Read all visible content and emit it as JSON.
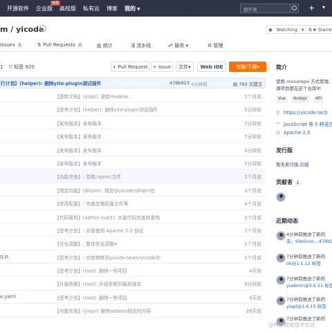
{
  "topnav": {
    "items": [
      "开源软件",
      "企业版",
      "高校版",
      "私有云",
      "博客",
      "我的"
    ],
    "hot_badge": "特惠",
    "search_placeholder": "搜开源"
  },
  "repo": {
    "title": "m / yicode",
    "watch_label": "Watching",
    "watch_count": "5",
    "star_label": "Starred"
  },
  "tabs": [
    {
      "label": "Issues",
      "count": "0"
    },
    {
      "label": "Pull Requests",
      "count": "0"
    },
    {
      "label": "统计"
    },
    {
      "label": "流水线"
    },
    {
      "label": "服务"
    },
    {
      "label": "管理"
    }
  ],
  "toolbar": {
    "stats_prefix": "1",
    "tags_label": "标签 920",
    "pull_request": "+ Pull Request",
    "issue": "+ Issue",
    "file": "文件",
    "web_ide": "Web IDE",
    "clone": "克隆/下载"
  },
  "latest_commit": {
    "message": "行计划】(helper): 删除yite-plugin测试插件",
    "hash": "478b923",
    "time": "4分钟前",
    "total": "793 次提交"
  },
  "files": [
    {
      "name": "",
      "msg": "【更新文档】(yiapi): 更新readme",
      "time": "2个月前"
    },
    {
      "name": "",
      "msg": "【思考计划】(helper): 删除yite-plugin测试插件",
      "time": "5分钟前"
    },
    {
      "name": "",
      "msg": "【发布版本】发布版本",
      "time": "7分钟前"
    },
    {
      "name": "",
      "msg": "【发布版本】发布版本",
      "time": "7分钟前"
    },
    {
      "name": "",
      "msg": "【发布版本】发布版本",
      "time": "4分钟前"
    },
    {
      "name": "",
      "msg": "【发布版本】发布版本",
      "time": "7分钟前"
    },
    {
      "name": "",
      "msg": "【功能完善】: 忽略.npmrc文件",
      "time": "2个月前"
    },
    {
      "name": "",
      "msg": "【增加功能】(dlnpm): 增加@yicode/dlnpm包",
      "time": "3个月前"
    },
    {
      "name": "",
      "msg": "【修改配置】: 完善忽略配置文件等",
      "time": "4个月前"
    },
    {
      "name": "",
      "msg": "【代码重构】(admin-vue3): 大量代码完善和重构",
      "time": "2个月前"
    },
    {
      "name": "",
      "msg": "【思考计划】: 全部使用 Apache 2.0 协议",
      "time": "2个月前"
    },
    {
      "name": "",
      "msg": "【优化调整】: 整体优化调整4",
      "time": "2个月前"
    },
    {
      "name": "g.js",
      "msg": "【思考计划】: 仓库转移到yicode-team/yicode中",
      "time": "1个月前"
    },
    {
      "name": "",
      "msg": "【思考计划】(root): 删除一些项目",
      "time": "4天前"
    },
    {
      "name": "",
      "msg": "【升级依赖】(root): 升级依赖到最新版本",
      "time": "9分钟前"
    },
    {
      "name": "e.yaml",
      "msg": "【思考计划】(root): 删除一些项目",
      "time": "4天前"
    },
    {
      "name": "",
      "msg": "【功能完善】(yiapi): 删除addons相关的内容",
      "time": "26天前"
    }
  ],
  "sidebar": {
    "intro_title": "简介",
    "intro_text_1": "使用 monorepo 方式管理,",
    "intro_text_2": "源项目都在这个仓库中",
    "tags": [
      "Vue",
      "Nodejs",
      "API"
    ],
    "website": "https://yicode.tech",
    "language": "JavaScript 等 5 种语言",
    "license": "Apache-2.0",
    "release_title": "发行版",
    "release_text": "暂无发行版,",
    "release_create": "创建",
    "contrib_title": "贡献者",
    "contrib_count": "1",
    "activity_title": "近期动态",
    "activity": [
      {
        "l1": "4分钟前推送了新的",
        "l2": "支。69e0cec...478b9"
      },
      {
        "l1": "7分钟前推送了新的",
        "l2": "ok@1.1.12 标签"
      },
      {
        "l1": "7分钟前推送了新的",
        "l2": "yiadmin@3.6.21 标签"
      },
      {
        "l1": "7分钟前推送了新的",
        "l2": "yiapi@1.6.15 标签"
      },
      {
        "l1": "7分钟前推送了新的",
        "l2": ""
      }
    ],
    "watermark": "@稀土掘金技术社区"
  }
}
